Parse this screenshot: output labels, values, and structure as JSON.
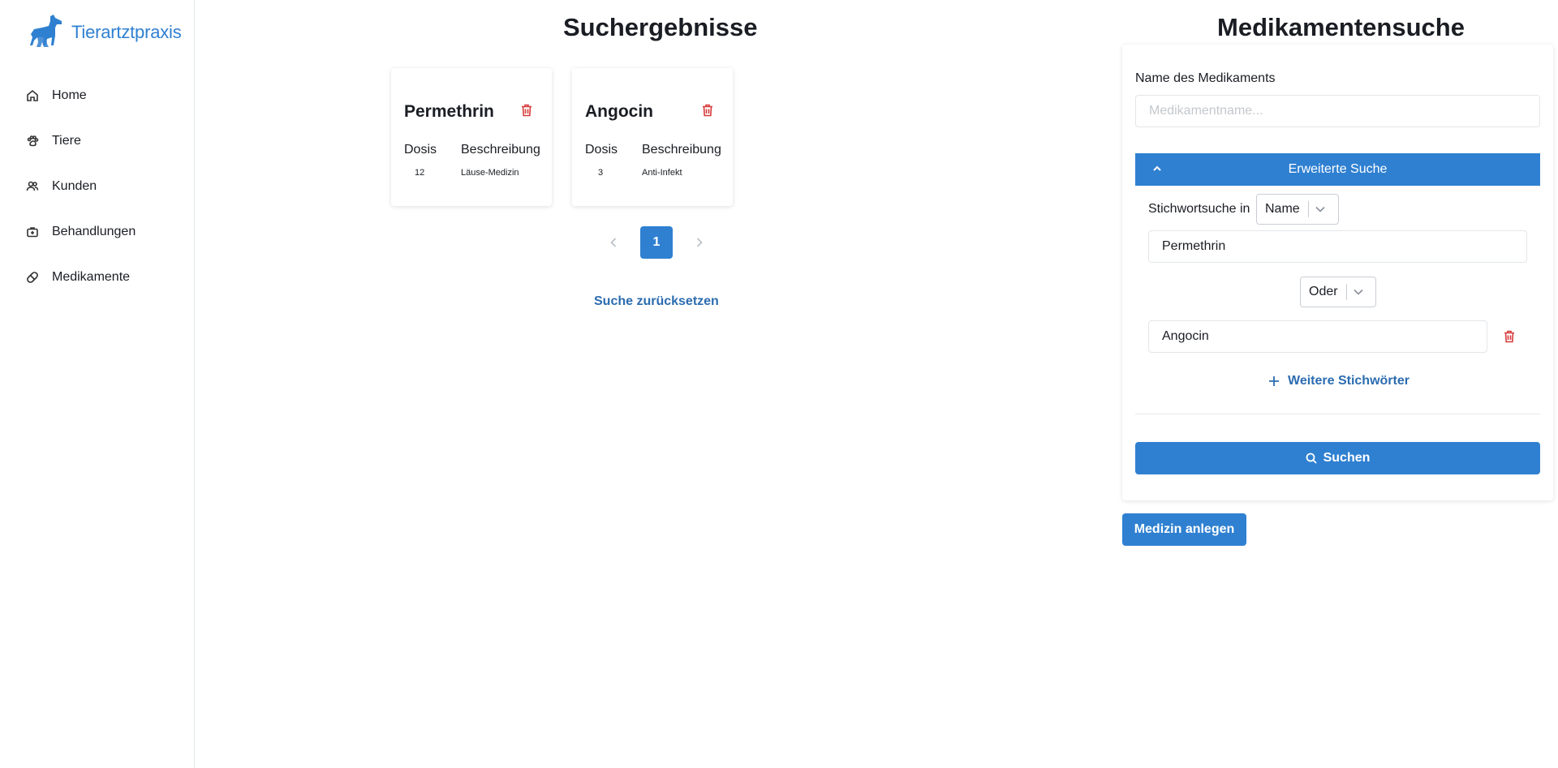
{
  "app": {
    "logo_text": "Tierartztpraxis",
    "accent_color": "#2f80d1",
    "danger_color": "#d83a3a"
  },
  "sidebar": {
    "items": [
      {
        "label": "Home",
        "icon": "home-icon"
      },
      {
        "label": "Tiere",
        "icon": "paw-icon"
      },
      {
        "label": "Kunden",
        "icon": "users-icon"
      },
      {
        "label": "Behandlungen",
        "icon": "medical-bag-icon"
      },
      {
        "label": "Medikamente",
        "icon": "pill-icon"
      }
    ]
  },
  "results": {
    "title": "Suchergebnisse",
    "cards": [
      {
        "name": "Permethrin",
        "dose_header": "Dosis",
        "desc_header": "Beschreibung",
        "dose": "12",
        "description": "Läuse-Medizin"
      },
      {
        "name": "Angocin",
        "dose_header": "Dosis",
        "desc_header": "Beschreibung",
        "dose": "3",
        "description": "Anti-Infekt"
      }
    ],
    "pagination": {
      "current_page": "1"
    },
    "reset_label": "Suche zurücksetzen"
  },
  "search": {
    "title": "Medikamentensuche",
    "name_label": "Name des Medikaments",
    "name_placeholder": "Medikamentname...",
    "advanced_label": "Erweiterte Suche",
    "keyword_label": "Stichwortsuche in",
    "field_select": "Name",
    "keyword_1": "Permethrin",
    "operator_select": "Oder",
    "keyword_2": "Angocin",
    "more_keywords_label": "Weitere Stichwörter",
    "search_button": "Suchen"
  },
  "create_button": "Medizin anlegen"
}
